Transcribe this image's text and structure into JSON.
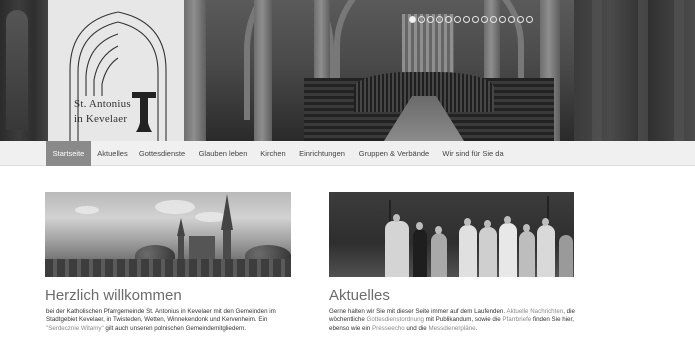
{
  "logo": {
    "line1": "St. Antonius",
    "line2": "in Kevelaer"
  },
  "slider": {
    "count": 14,
    "active": 0
  },
  "nav": {
    "items": [
      {
        "label": "Startseite",
        "active": true
      },
      {
        "label": "Aktuelles",
        "active": false
      },
      {
        "label": "Gottesdienste",
        "active": false
      },
      {
        "label": "Glauben leben",
        "active": false
      },
      {
        "label": "Kirchen",
        "active": false
      },
      {
        "label": "Einrichtungen",
        "active": false
      },
      {
        "label": "Gruppen & Verbände",
        "active": false
      },
      {
        "label": "Wir sind für Sie da",
        "active": false
      }
    ]
  },
  "welcome": {
    "title": "Herzlich willkommen",
    "text1": "bei der Katholischen Pfarrgemeinde St. Antonius in Kevelaer mit den Gemeinden im Stadtgebiet Kevelaer, in Twisteden, Wetten, Winnekendonk und Kervenheim. Ein ",
    "link1": "\"Serdecznie Witamy\"",
    "text2": " gilt auch unseren polnischen Gemeindemitgliedern."
  },
  "news": {
    "title": "Aktuelles",
    "text1": "Gerne halten wir Sie mit dieser Seite immer auf dem Laufenden. ",
    "link1": "Aktuelle Nachrichten",
    "text2": ", die wöchentliche ",
    "link2": "Gottesdienstordnung",
    "text3": " mit Publikandum, sowie die ",
    "link3": "Pfarrbriefe",
    "text4": " finden Sie hier, ebenso wie ein ",
    "link4": "Presseecho",
    "text5": " und die ",
    "link5": "Messdienerpläne",
    "text6": "."
  },
  "colors": {
    "nav_active_bg": "#8a8a8a",
    "nav_bg": "#f0f0f0",
    "heading": "#6c6c6c",
    "link": "#8a8a8a"
  }
}
